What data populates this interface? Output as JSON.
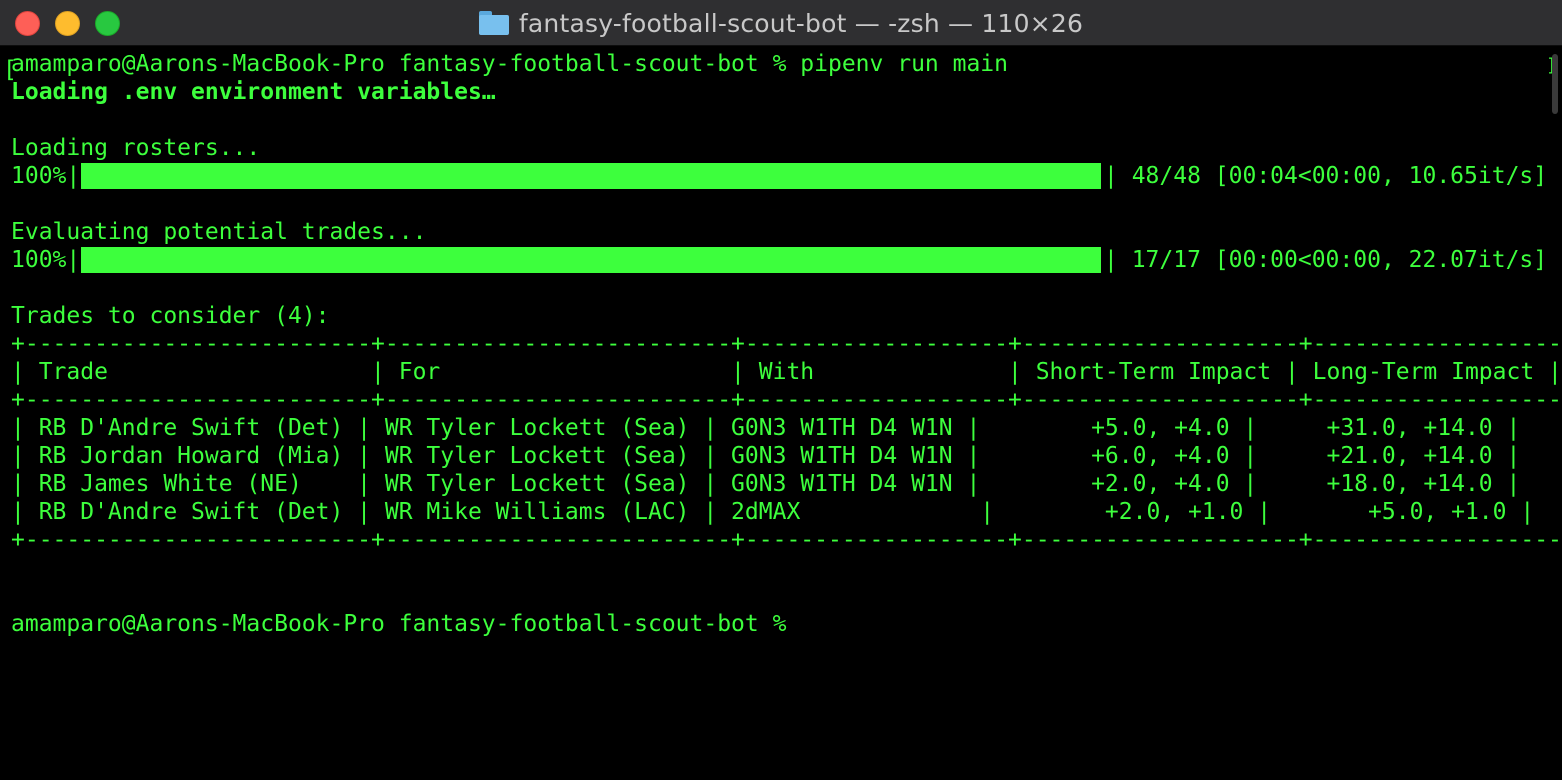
{
  "window": {
    "title": "fantasy-football-scout-bot — -zsh — 110×26"
  },
  "terminal": {
    "command_line": "amamparo@Aarons-MacBook-Pro fantasy-football-scout-bot % pipenv run main",
    "env_line": "Loading .env environment variables…",
    "loading_rosters": "Loading rosters...",
    "progress1": {
      "percent_label": "100%|",
      "stats": "| 48/48 [00:04<00:00, 10.65it/s]",
      "fraction": 1.0
    },
    "evaluating": "Evaluating potential trades...",
    "progress2": {
      "percent_label": "100%|",
      "stats": "| 17/17 [00:00<00:00, 22.07it/s]",
      "fraction": 1.0
    },
    "trades_heading": "Trades to consider (4):",
    "table": {
      "border": "+-------------------------+-------------------------+-------------------+--------------------+-------------------+",
      "header": "| Trade                   | For                     | With              | Short-Term Impact | Long-Term Impact |",
      "rows": [
        "| RB D'Andre Swift (Det) | WR Tyler Lockett (Sea) | G0N3 W1TH D4 W1N |        +5.0, +4.0 |     +31.0, +14.0 |",
        "| RB Jordan Howard (Mia) | WR Tyler Lockett (Sea) | G0N3 W1TH D4 W1N |        +6.0, +4.0 |     +21.0, +14.0 |",
        "| RB James White (NE)    | WR Tyler Lockett (Sea) | G0N3 W1TH D4 W1N |        +2.0, +4.0 |     +18.0, +14.0 |",
        "| RB D'Andre Swift (Det) | WR Mike Williams (LAC) | 2dMAX             |        +2.0, +1.0 |       +5.0, +1.0 |"
      ]
    },
    "prompt": "amamparo@Aarons-MacBook-Pro fantasy-football-scout-bot % "
  },
  "colors": {
    "text": "#3dff3d",
    "background": "#000000",
    "titlebar": "#2f2f31"
  },
  "icons": {
    "title_icon": "folder-icon"
  }
}
